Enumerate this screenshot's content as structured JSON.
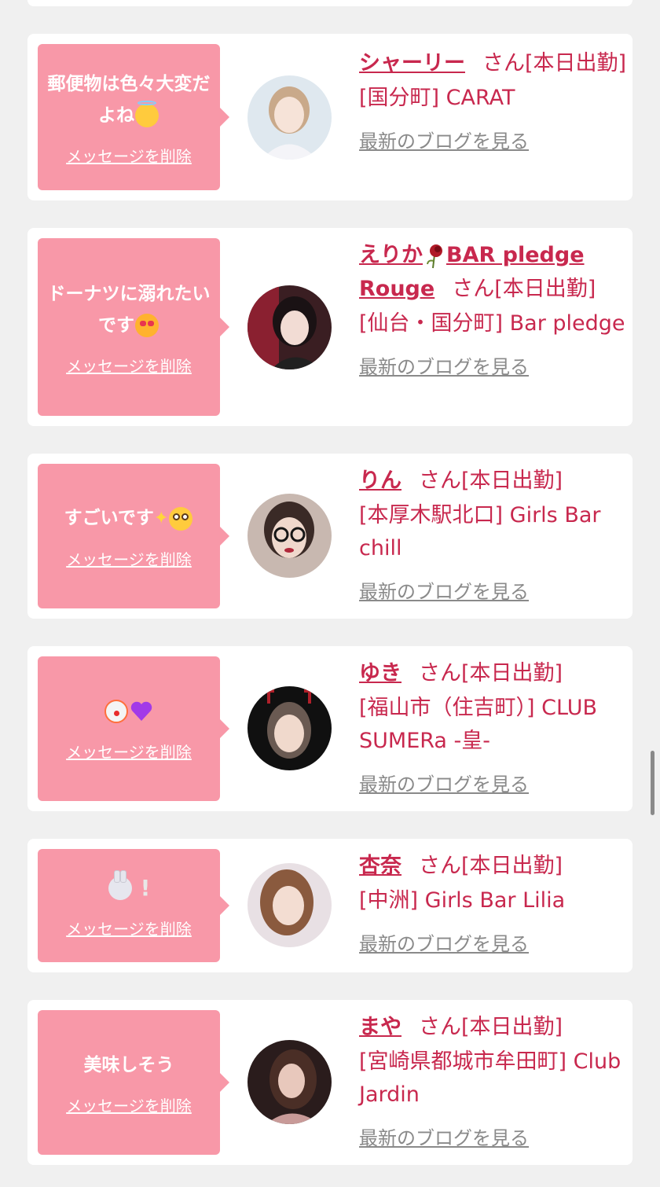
{
  "common": {
    "delete_label": "メッセージを削除",
    "san_label": "さん[本日出勤]",
    "blog_label": "最新のブログを見る"
  },
  "cards": [
    {
      "message": "郵便物は色々大変だよね",
      "message_emoji": [
        "smiling-face-with-halo"
      ],
      "name": "シャーリー",
      "shop": "[国分町] CARAT"
    },
    {
      "message": "ドーナツに溺れたいです",
      "message_emoji": [
        "smiling-cat-with-heart-eyes"
      ],
      "name_part1": "えりか",
      "name_icon": "wilted-rose",
      "name_part2": "BAR pledge Rouge",
      "shop": "[仙台・国分町] Bar pledge"
    },
    {
      "message": "すごいです",
      "message_emoji": [
        "sparkles",
        "flushed-face"
      ],
      "name": "りん",
      "shop": "[本厚木駅北口] Girls Bar chill"
    },
    {
      "message": "",
      "message_emoji": [
        "clown-face",
        "purple-heart"
      ],
      "name": "ゆき",
      "shop": "[福山市（住吉町）] CLUB SUMERa -皇-"
    },
    {
      "message": "",
      "message_emoji": [
        "rabbit-face",
        "white-exclamation"
      ],
      "name": "杏奈",
      "shop": "[中洲] Girls Bar Lilia"
    },
    {
      "message": "美味しそう",
      "message_emoji": [],
      "name": "まや",
      "shop": "[宮崎県都城市牟田町] Club Jardin"
    }
  ],
  "colors": {
    "background": "#f0f0f0",
    "card": "#ffffff",
    "bubble": "#f898a8",
    "accent": "#c8284e",
    "muted": "#8a8a8a"
  }
}
